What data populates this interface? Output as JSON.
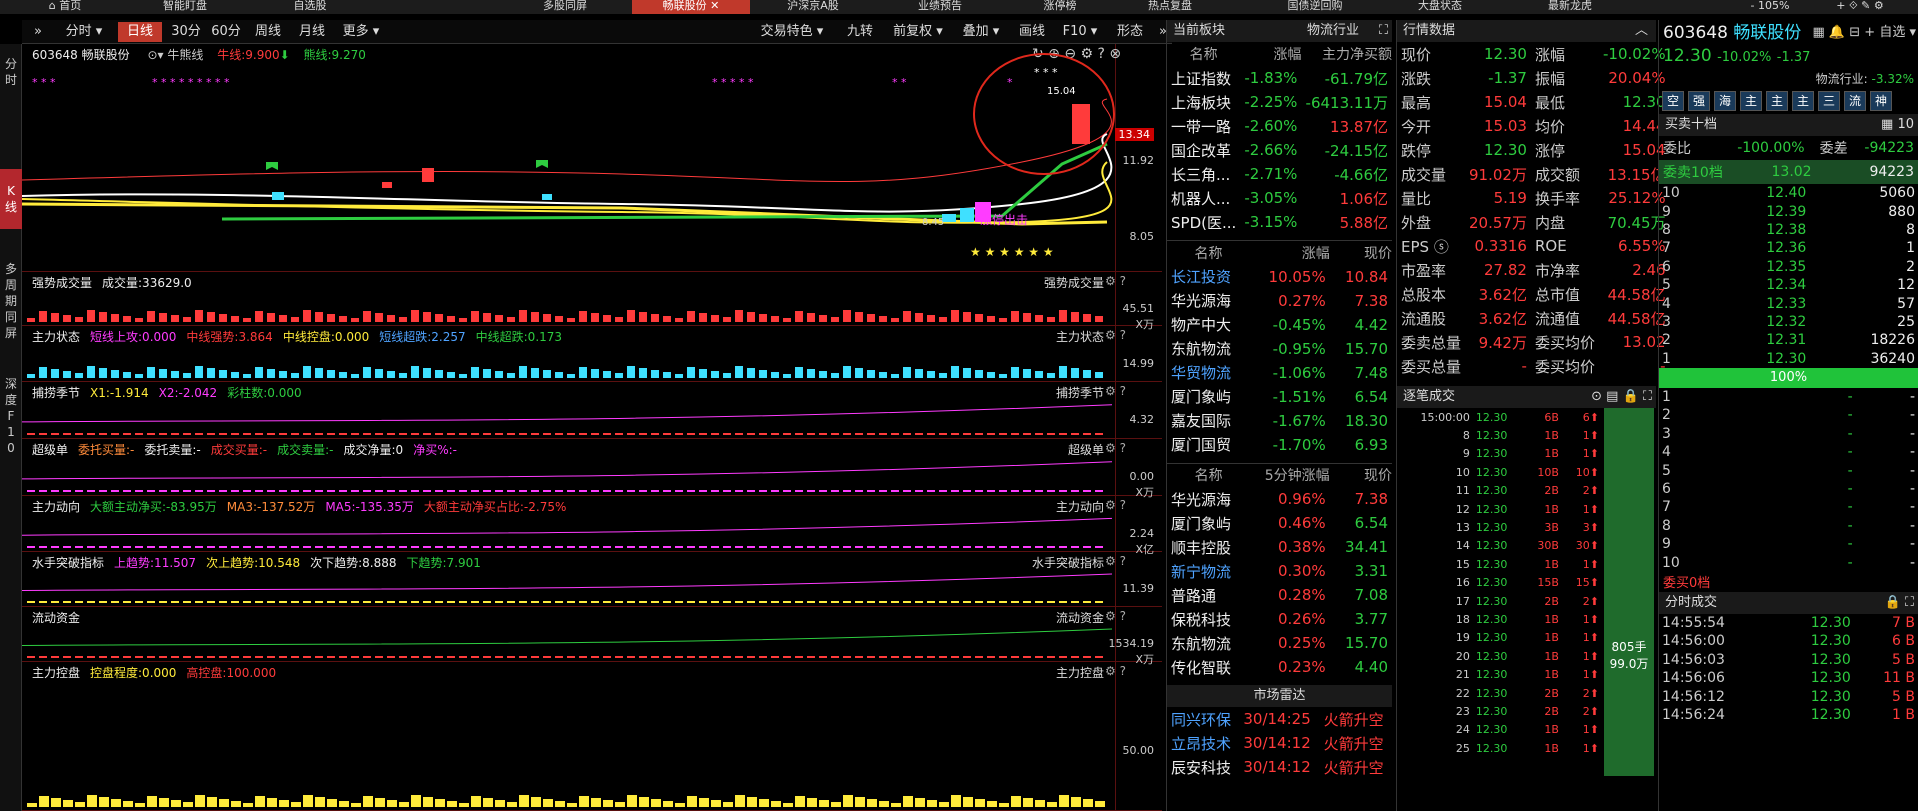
{
  "topbar": {
    "tabs": [
      "首页",
      "智能盯盘",
      "自选股",
      "多股同屏",
      "畅联股份",
      "沪深京A股",
      "业绩预告",
      "涨停榜",
      "热点复盘",
      "国债逆回购",
      "大盘状态",
      "最新龙虎"
    ],
    "zoom": "105%"
  },
  "left_tabs": [
    "分时",
    "K线",
    "多周期同屏",
    "深度F10"
  ],
  "toolbar": {
    "left": [
      "分时",
      "日线",
      "30分",
      "60分",
      "周线",
      "月线",
      "更多"
    ],
    "right": [
      "交易特色",
      "九转",
      "前复权",
      "叠加",
      "画线",
      "F10",
      "形态"
    ]
  },
  "kline": {
    "header": "603648 畅联股份",
    "ind_name": "牛熊线",
    "ma1": "牛线:9.900",
    "ma2": "熊线:9.270",
    "high_label": "15.04",
    "low_label": "8.45",
    "limit_up_label": "涨停出击",
    "yaxis": [
      "13.34",
      "11.92",
      "8.05"
    ],
    "price_tag": "13.34"
  },
  "panels": [
    {
      "name": "强势成交量",
      "items": [
        [
          "成交量:33629.0",
          "white"
        ]
      ],
      "axis": [
        "45.51",
        "X万"
      ]
    },
    {
      "name": "主力状态",
      "items": [
        [
          "短线上攻:0.000",
          "mag"
        ],
        [
          "中线强势:3.864",
          "red"
        ],
        [
          "中线控盘:0.000",
          "yellow"
        ],
        [
          "短线超跌:2.257",
          "blue"
        ],
        [
          "中线超跌:0.173",
          "green"
        ]
      ],
      "axis": [
        "14.99"
      ]
    },
    {
      "name": "捕捞季节",
      "items": [
        [
          "X1:-1.914",
          "yellow"
        ],
        [
          "X2:-2.042",
          "mag"
        ],
        [
          "彩柱数:0.000",
          "green"
        ]
      ],
      "axis": [
        "4.32"
      ]
    },
    {
      "name": "超级单",
      "items": [
        [
          "委托买量:-",
          "orange"
        ],
        [
          "委托卖量:-",
          "white"
        ],
        [
          "成交买量:-",
          "red"
        ],
        [
          "成交卖量:-",
          "green"
        ],
        [
          "成交净量:0",
          "white"
        ],
        [
          "净买%:-",
          "mag"
        ]
      ],
      "axis": [
        "0.00",
        "X万"
      ]
    },
    {
      "name": "主力动向",
      "items": [
        [
          "大额主动净买:-83.95万",
          "green"
        ],
        [
          "MA3:-137.52万",
          "orange"
        ],
        [
          "MA5:-135.35万",
          "mag"
        ],
        [
          "大额主动净买占比:-2.75%",
          "red"
        ]
      ],
      "axis": [
        "2.24",
        "X亿"
      ]
    },
    {
      "name": "水手突破指标",
      "items": [
        [
          "上趋势:11.507",
          "mag"
        ],
        [
          "次上趋势:10.548",
          "yellow"
        ],
        [
          "次下趋势:8.888",
          "white"
        ],
        [
          "下趋势:7.901",
          "green"
        ]
      ],
      "axis": [
        "11.39"
      ]
    },
    {
      "name": "流动资金",
      "items": [],
      "axis": [
        "1534.19",
        "X万"
      ]
    },
    {
      "name": "主力控盘",
      "items": [
        [
          "控盘程度:0.000",
          "yellow"
        ],
        [
          "高控盘:100.000",
          "red"
        ]
      ],
      "axis": [
        "50.00"
      ]
    }
  ],
  "sector": {
    "title": "当前板块",
    "sub": "物流行业",
    "headers": [
      "名称",
      "涨幅",
      "主力净买额"
    ],
    "rows": [
      [
        "上证指数",
        "-1.83%",
        "-61.79亿"
      ],
      [
        "上海板块",
        "-2.25%",
        "-6413.11万"
      ],
      [
        "一带一路",
        "-2.60%",
        "13.87亿"
      ],
      [
        "国企改革",
        "-2.66%",
        "-24.15亿"
      ],
      [
        "长三角...",
        "-2.71%",
        "-4.66亿"
      ],
      [
        "机器人...",
        "-3.05%",
        "1.06亿"
      ],
      [
        "SPD(医...",
        "-3.15%",
        "5.88亿"
      ]
    ]
  },
  "peers": {
    "headers": [
      "名称",
      "涨幅",
      "现价"
    ],
    "rows": [
      [
        "长江投资",
        "10.05%",
        "10.84"
      ],
      [
        "华光源海",
        "0.27%",
        "7.38"
      ],
      [
        "物产中大",
        "-0.45%",
        "4.42"
      ],
      [
        "东航物流",
        "-0.95%",
        "15.70"
      ],
      [
        "华贸物流",
        "-1.06%",
        "7.48"
      ],
      [
        "厦门象屿",
        "-1.51%",
        "6.54"
      ],
      [
        "嘉友国际",
        "-1.67%",
        "18.30"
      ],
      [
        "厦门国贸",
        "-1.70%",
        "6.93"
      ]
    ]
  },
  "fivemin": {
    "headers": [
      "名称",
      "5分钟涨幅",
      "现价"
    ],
    "rows": [
      [
        "华光源海",
        "0.96%",
        "7.38"
      ],
      [
        "厦门象屿",
        "0.46%",
        "6.54"
      ],
      [
        "顺丰控股",
        "0.38%",
        "34.41"
      ],
      [
        "新宁物流",
        "0.30%",
        "3.31"
      ],
      [
        "普路通",
        "0.28%",
        "7.08"
      ],
      [
        "保税科技",
        "0.26%",
        "3.77"
      ],
      [
        "东航物流",
        "0.25%",
        "15.70"
      ],
      [
        "传化智联",
        "0.23%",
        "4.40"
      ]
    ]
  },
  "radar": {
    "title": "市场雷达",
    "rows": [
      [
        "同兴环保",
        "30/14:25",
        "火箭升空"
      ],
      [
        "立昂技术",
        "30/14:12",
        "火箭升空"
      ],
      [
        "辰安科技",
        "30/14:12",
        "火箭升空"
      ]
    ]
  },
  "quote": {
    "title": "行情数据",
    "rows": [
      [
        "现价",
        "12.30",
        "涨幅",
        "-10.02%"
      ],
      [
        "涨跌",
        "-1.37",
        "振幅",
        "20.04%"
      ],
      [
        "最高",
        "15.04",
        "最低",
        "12.30"
      ],
      [
        "今开",
        "15.03",
        "均价",
        "14.44"
      ],
      [
        "跌停",
        "12.30",
        "涨停",
        "15.04"
      ],
      [
        "成交量",
        "91.02万",
        "成交额",
        "13.15亿"
      ],
      [
        "量比",
        "5.19",
        "换手率",
        "25.12%"
      ],
      [
        "外盘",
        "20.57万",
        "内盘",
        "70.45万"
      ],
      [
        "EPS ⓢ",
        "0.3316",
        "ROE",
        "6.55%"
      ],
      [
        "市盈率",
        "27.82",
        "市净率",
        "2.46"
      ],
      [
        "总股本",
        "3.62亿",
        "总市值",
        "44.58亿"
      ],
      [
        "流通股",
        "3.62亿",
        "流通值",
        "44.58亿"
      ],
      [
        "委卖总量",
        "9.42万",
        "委买均价",
        "13.02"
      ],
      [
        "委买总量",
        "-",
        "委买均价",
        "-"
      ]
    ]
  },
  "ticks": {
    "title": "逐笔成交",
    "vol_label": "805手",
    "amt_label": "99.0万",
    "rows": [
      [
        "15:00:00",
        "12.30",
        "6B",
        "6"
      ],
      [
        "8",
        "12.30",
        "1B",
        "1"
      ],
      [
        "9",
        "12.30",
        "1B",
        "1"
      ],
      [
        "10",
        "12.30",
        "10B",
        "10"
      ],
      [
        "11",
        "12.30",
        "2B",
        "2"
      ],
      [
        "12",
        "12.30",
        "1B",
        "1"
      ],
      [
        "13",
        "12.30",
        "3B",
        "3"
      ],
      [
        "14",
        "12.30",
        "30B",
        "30"
      ],
      [
        "15",
        "12.30",
        "1B",
        "1"
      ],
      [
        "16",
        "12.30",
        "15B",
        "15"
      ],
      [
        "17",
        "12.30",
        "2B",
        "2"
      ],
      [
        "18",
        "12.30",
        "1B",
        "1"
      ],
      [
        "19",
        "12.30",
        "1B",
        "1"
      ],
      [
        "20",
        "12.30",
        "1B",
        "1"
      ],
      [
        "21",
        "12.30",
        "1B",
        "1"
      ],
      [
        "22",
        "12.30",
        "2B",
        "2"
      ],
      [
        "23",
        "12.30",
        "2B",
        "2"
      ],
      [
        "24",
        "12.30",
        "1B",
        "1"
      ],
      [
        "25",
        "12.30",
        "1B",
        "1"
      ]
    ]
  },
  "stock": {
    "code": "603648",
    "name": "畅联股份",
    "price": "12.30",
    "change_pct": "-10.02%",
    "change": "-1.37",
    "industry": "物流行业:",
    "industry_pct": "-3.32%",
    "watch": "自选",
    "tags": [
      "空",
      "强",
      "海",
      "主",
      "主",
      "主",
      "三",
      "流",
      "神"
    ]
  },
  "orderbook": {
    "title": "买卖十档",
    "num": "10",
    "weibi": "委比",
    "weibi_v": "-100.00%",
    "weicha": "委差",
    "weicha_v": "-94223",
    "sell10": "委卖10档",
    "sell10_p": "13.02",
    "sell10_v": "94223",
    "asks": [
      [
        "10",
        "12.40",
        "5060"
      ],
      [
        "9",
        "12.39",
        "880"
      ],
      [
        "8",
        "12.38",
        "8"
      ],
      [
        "7",
        "12.36",
        "1"
      ],
      [
        "6",
        "12.35",
        "2"
      ],
      [
        "5",
        "12.34",
        "12"
      ],
      [
        "4",
        "12.33",
        "57"
      ],
      [
        "3",
        "12.32",
        "25"
      ],
      [
        "2",
        "12.31",
        "18226"
      ],
      [
        "1",
        "12.30",
        "36240"
      ]
    ],
    "ratio": "100%",
    "bids": [
      [
        "1",
        "-",
        "-"
      ],
      [
        "2",
        "-",
        "-"
      ],
      [
        "3",
        "-",
        "-"
      ],
      [
        "4",
        "-",
        "-"
      ],
      [
        "5",
        "-",
        "-"
      ],
      [
        "6",
        "-",
        "-"
      ],
      [
        "7",
        "-",
        "-"
      ],
      [
        "8",
        "-",
        "-"
      ],
      [
        "9",
        "-",
        "-"
      ],
      [
        "10",
        "-",
        "-"
      ]
    ],
    "buy0": "委买0档"
  },
  "timesales": {
    "title": "分时成交",
    "rows": [
      [
        "14:55:54",
        "12.30",
        "7 B"
      ],
      [
        "14:56:00",
        "12.30",
        "6 B"
      ],
      [
        "14:56:03",
        "12.30",
        "5 B"
      ],
      [
        "14:56:06",
        "12.30",
        "11 B"
      ],
      [
        "14:56:12",
        "12.30",
        "5 B"
      ],
      [
        "14:56:24",
        "12.30",
        "1 B"
      ]
    ]
  }
}
